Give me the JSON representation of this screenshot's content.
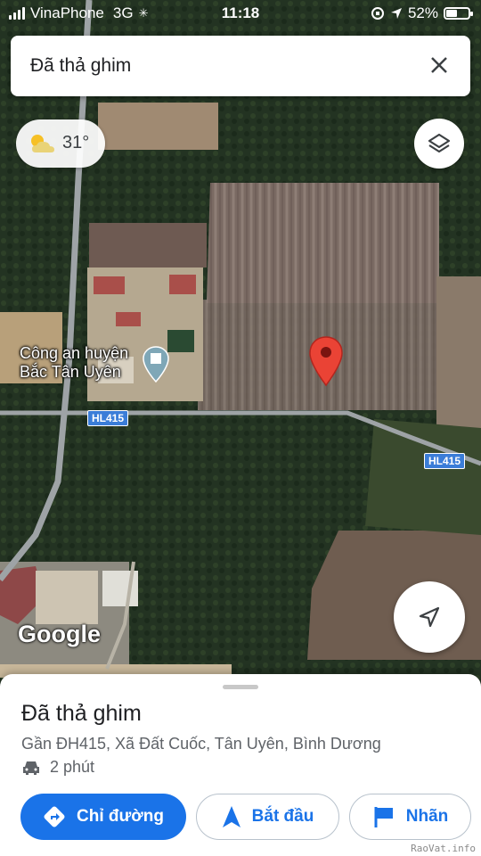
{
  "status_bar": {
    "carrier": "VinaPhone",
    "network": "3G",
    "time": "11:18",
    "battery": "52%",
    "battery_level": 0.52
  },
  "search": {
    "title": "Đã thả ghim"
  },
  "weather": {
    "temperature": "31°"
  },
  "map": {
    "poi_line1": "Công an huyện",
    "poi_line2": "Bắc Tân Uyên",
    "road_label_1": "HL415",
    "road_label_2": "HL415",
    "logo": "Google",
    "pin_color": "#ea4335"
  },
  "place": {
    "title": "Đã thả ghim",
    "address": "Gần ĐH415, Xã Đất Cuốc, Tân Uyên, Bình Dương",
    "eta": "2 phút"
  },
  "actions": {
    "directions": "Chỉ đường",
    "start": "Bắt đầu",
    "label": "Nhãn"
  },
  "watermark": "RaoVat.info",
  "colors": {
    "accent": "#1a73e8"
  }
}
